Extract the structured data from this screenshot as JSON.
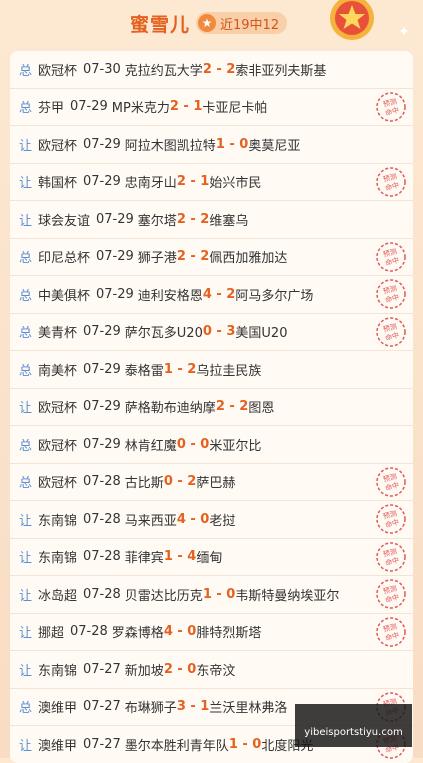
{
  "header": {
    "title": "蜜雪儿",
    "badge": "近19中12"
  },
  "colors": {
    "accent": "#e4611f",
    "type_label": "#5a8fd6",
    "stamp": "#e05a5a"
  },
  "stamp_text": "预测命中",
  "rows": [
    {
      "type": "总",
      "league": "欧冠杯",
      "date": "07-30",
      "home": "克拉约瓦大学",
      "score": "2 - 2",
      "away": "索非亚列夫斯基",
      "hit": false
    },
    {
      "type": "总",
      "league": "芬甲",
      "date": "07-29",
      "home": "MP米克力",
      "score": "2 - 1",
      "away": "卡亚尼卡帕",
      "hit": true
    },
    {
      "type": "让",
      "league": "欧冠杯",
      "date": "07-29",
      "home": "阿拉木图凯拉特",
      "score": "1 - 0",
      "away": "奥莫尼亚",
      "hit": false
    },
    {
      "type": "让",
      "league": "韩国杯",
      "date": "07-29",
      "home": "忠南牙山",
      "score": "2 - 1",
      "away": "始兴市民",
      "hit": true
    },
    {
      "type": "让",
      "league": "球会友谊",
      "date": "07-29",
      "home": "塞尔塔",
      "score": "2 - 2",
      "away": "维塞乌",
      "hit": false
    },
    {
      "type": "总",
      "league": "印尼总杯",
      "date": "07-29",
      "home": "狮子港",
      "score": "2 - 2",
      "away": "佩西加雅加达",
      "hit": true
    },
    {
      "type": "总",
      "league": "中美俱杯",
      "date": "07-29",
      "home": "迪利安格恩",
      "score": "4 - 2",
      "away": "阿马多尔广场",
      "hit": true
    },
    {
      "type": "总",
      "league": "美青杯",
      "date": "07-29",
      "home": "萨尔瓦多U20",
      "score": "0 - 3",
      "away": "美国U20",
      "hit": true
    },
    {
      "type": "总",
      "league": "南美杯",
      "date": "07-29",
      "home": "泰格雷",
      "score": "1 - 2",
      "away": "乌拉圭民族",
      "hit": false
    },
    {
      "type": "让",
      "league": "欧冠杯",
      "date": "07-29",
      "home": "萨格勒布迪纳摩",
      "score": "2 - 2",
      "away": "图恩",
      "hit": false
    },
    {
      "type": "总",
      "league": "欧冠杯",
      "date": "07-29",
      "home": "林肯红魔",
      "score": "0 - 0",
      "away": "米亚尔比",
      "hit": false
    },
    {
      "type": "总",
      "league": "欧冠杯",
      "date": "07-28",
      "home": "古比斯",
      "score": "0 - 2",
      "away": "萨巴赫",
      "hit": true
    },
    {
      "type": "让",
      "league": "东南锦",
      "date": "07-28",
      "home": "马来西亚",
      "score": "4 - 0",
      "away": "老挝",
      "hit": true
    },
    {
      "type": "让",
      "league": "东南锦",
      "date": "07-28",
      "home": "菲律宾",
      "score": "1 - 4",
      "away": "缅甸",
      "hit": true
    },
    {
      "type": "让",
      "league": "冰岛超",
      "date": "07-28",
      "home": "贝雷达比历克",
      "score": "1 - 0",
      "away": "韦斯特曼纳埃亚尔",
      "hit": true
    },
    {
      "type": "让",
      "league": "挪超",
      "date": "07-28",
      "home": "罗森博格",
      "score": "4 - 0",
      "away": "腓特烈斯塔",
      "hit": true
    },
    {
      "type": "让",
      "league": "东南锦",
      "date": "07-27",
      "home": "新加坡",
      "score": "2 - 0",
      "away": "东帝汶",
      "hit": false
    },
    {
      "type": "总",
      "league": "澳维甲",
      "date": "07-27",
      "home": "布琳狮子",
      "score": "3 - 1",
      "away": "兰沃里林弗洛",
      "hit": true
    },
    {
      "type": "让",
      "league": "澳维甲",
      "date": "07-27",
      "home": "墨尔本胜利青年队",
      "score": "1 - 0",
      "away": "北度阳光",
      "hit": true
    }
  ],
  "watermark": {
    "line1": " ",
    "line2": "yibeisportstiyu.com"
  }
}
